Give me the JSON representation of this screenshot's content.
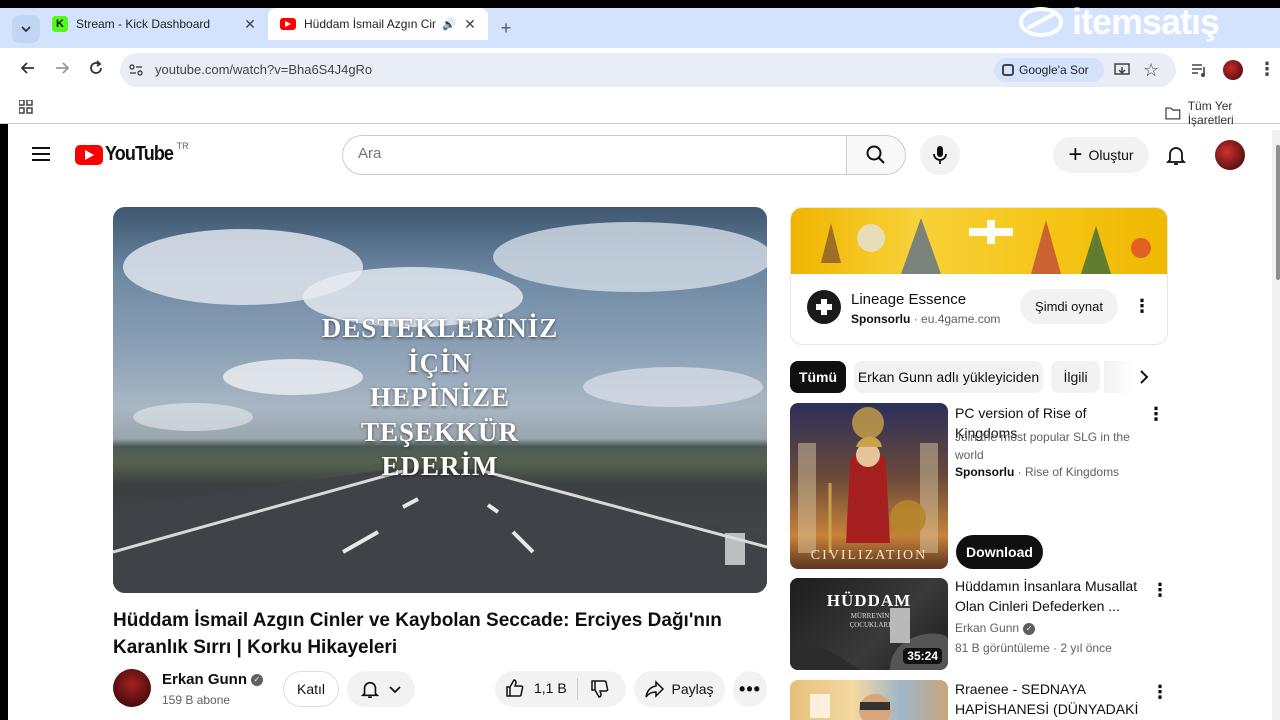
{
  "browser": {
    "tabs": [
      {
        "title": "Stream - Kick Dashboard",
        "close": "✕"
      },
      {
        "title": "Hüddam İsmail Azgın Cinler ve Kaybolan Seccade: Erciyes Dağı'nın Karanlık Sırrı",
        "audio": "🔊",
        "close": "✕"
      }
    ],
    "new_tab": "+",
    "url": "youtube.com/watch?v=Bha6S4J4gRo",
    "google_lens": "Google'a Sor",
    "bookmarks_all": "Tüm Yer İşaretleri",
    "watermark": "itemsatış"
  },
  "youtube": {
    "logo_text": "YouTube",
    "logo_region": "TR",
    "search_placeholder": "Ara",
    "create_label": "Oluştur"
  },
  "video": {
    "overlay_lines": [
      "DESTEKLERİNİZ",
      "İÇİN",
      "HEPİNİZE",
      "TEŞEKKÜR",
      "EDERİM"
    ],
    "title": "Hüddam İsmail Azgın Cinler ve Kaybolan Seccade: Erciyes Dağı'nın Karanlık Sırrı | Korku Hikayeleri",
    "channel": "Erkan Gunn",
    "subscribers": "159 B abone",
    "join_label": "Katıl",
    "likes": "1,1 B",
    "share_label": "Paylaş"
  },
  "ad": {
    "name": "Lineage Essence",
    "sponsored": "Sponsorlu",
    "domain": "eu.4game.com",
    "cta": "Şimdi oynat"
  },
  "chips": [
    "Tümü",
    "Erkan Gunn adlı yükleyiciden",
    "İlgili"
  ],
  "recommendations": [
    {
      "title": "PC version of Rise of Kingdoms",
      "desc": "Join the most popular SLG in the world",
      "sponsored": "Sponsorlu",
      "channel": "Rise of Kingdoms",
      "cta": "Download",
      "thumb_text": "CIVILIZATION"
    },
    {
      "title": "Hüddamın İnsanlara Musallat Olan Cinleri Defederken ...",
      "channel": "Erkan Gunn",
      "views": "81 B görüntüleme",
      "age": "2 yıl önce",
      "duration": "35:24",
      "thumb_title": "HÜDDAM",
      "thumb_sub": "MÜRRE'NİN ÇOCUKLARI"
    },
    {
      "title": "Rraenee - SEDNAYA HAPİSHANESİ (DÜNYADAKİ ..."
    }
  ],
  "colors": {
    "youtube_red": "#ff0000",
    "tab_strip": "#d3e3fd",
    "omnibox": "#e9eef6",
    "chip_active": "#0f0f0f",
    "ad_banner": "#f5c518"
  }
}
